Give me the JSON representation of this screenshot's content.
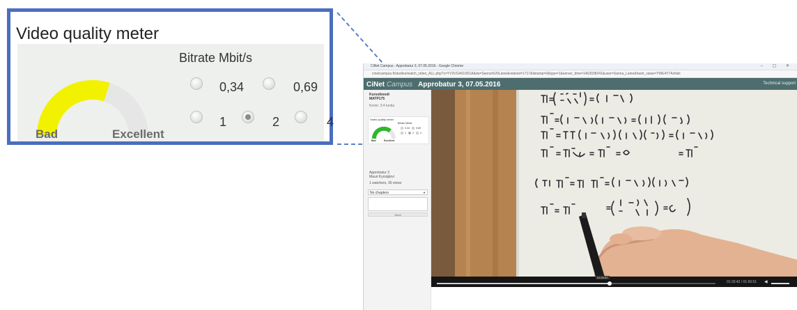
{
  "zoom": {
    "title": "Video quality meter",
    "bitrate_title": "Bitrate Mbit/s",
    "options": [
      {
        "label": "0,34",
        "selected": false
      },
      {
        "label": "0,69",
        "selected": false
      },
      {
        "label": "1",
        "selected": false
      },
      {
        "label": "2",
        "selected": true
      },
      {
        "label": "4",
        "selected": false
      }
    ],
    "gauge": {
      "low_label": "Bad",
      "high_label": "Excellent",
      "level": 0.6,
      "fill_color": "#f2f200",
      "track_color": "#e6e6e6"
    }
  },
  "browser": {
    "window_title": "CiNet Campus - Approbatur 3, 07.05.2016 - Google Chrome",
    "window_controls": "– ▢ ✕",
    "url": "cinetcampus.fi/studies/watch_video_ALL.php?c=YV3VG4610D1A&du=Sanna%20Laine&videoid=1717&listamp=0&type=1&server_time=1463038241&user=Sanna_Laine&hash_value=YWE4Y7AxNzk",
    "logo_main": "CiNet",
    "logo_sub": "Campus",
    "page_title": "Approbatur 3, 07.05.2016",
    "support": "Technical support",
    "sidebar": {
      "course_line1": "Kurssikoodi",
      "course_line2": "MATP175",
      "subtitle": "Kesto: 3:4 tuntia",
      "mini_title": "Video quality meter",
      "mini_bitrate": "Bitrate Mbit/s",
      "mini_bad": "Bad",
      "mini_excellent": "Excellent",
      "mini_options": [
        "0,34",
        "0,69",
        "1",
        "2",
        "4"
      ],
      "meta1": "Approbatur 3",
      "meta2": "Mauri Kyrsäjärvi",
      "views": "1 watchers, 30 views",
      "chapters": "No chapters",
      "send": "Send"
    },
    "player": {
      "time": "01:33:42 / 01:50:51",
      "tooltip": "01:00:57",
      "progress": 0.62
    }
  }
}
